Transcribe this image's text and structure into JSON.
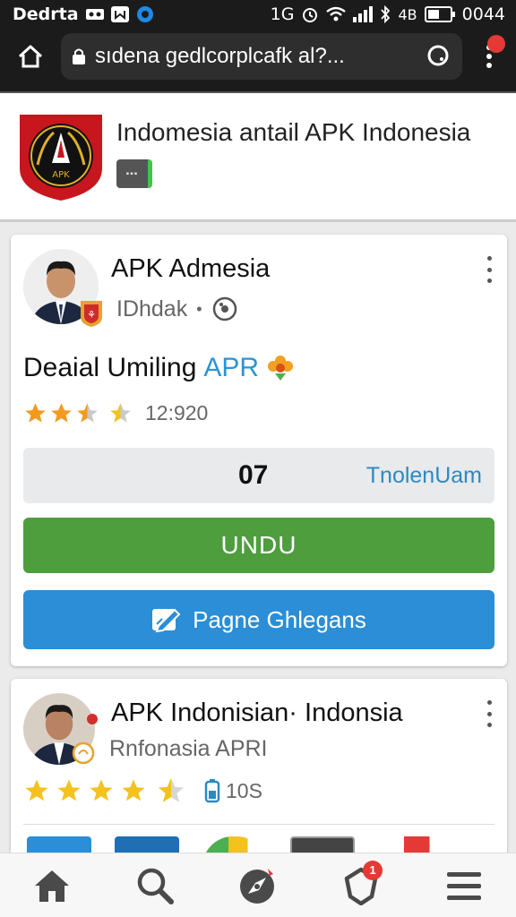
{
  "status_bar": {
    "carrier": "Dedrta",
    "network": "1G",
    "battery_label": "4B",
    "time": "0044"
  },
  "browser": {
    "url": "sıdena gedlcorplcafk al?..."
  },
  "site": {
    "title": "Indomesia antail APK Indonesia",
    "logo_text": "APK"
  },
  "app1": {
    "name": "APK Admesia",
    "developer": "IDhdak",
    "description": "Deaial Umiling",
    "description_accent": "APR",
    "rating_text": "12:920",
    "stars": 2.5,
    "info_count": "07",
    "info_link": "TnolenUam",
    "download_label": "UNDU",
    "page_label": "Pagne Ghlegans"
  },
  "app2": {
    "name": "APK Indonisian· Indonsia",
    "developer": "Rnfonasia APRI",
    "size_text": "10S",
    "stars": 4.5
  },
  "bottom_nav": {
    "notifications_count": "1"
  },
  "colors": {
    "download_green": "#4e9e3e",
    "page_blue": "#2b8ed6",
    "accent_blue": "#2b95d5",
    "star_orange": "#f39a1e",
    "star_yellow": "#f4c21c"
  }
}
